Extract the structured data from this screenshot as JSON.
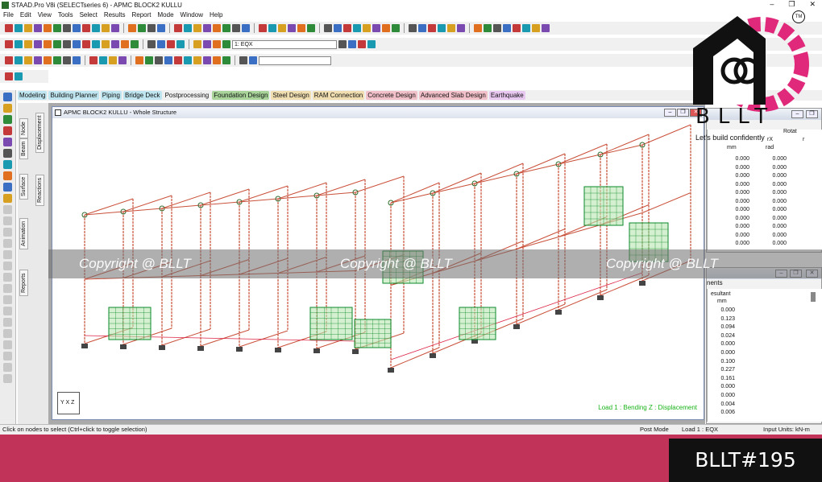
{
  "window": {
    "title": "STAAD.Pro V8i (SELECTseries 6) - APMC BLOCK2 KULLU",
    "minimize": "–",
    "restore": "❐",
    "close": "✕"
  },
  "menu": [
    "File",
    "Edit",
    "View",
    "Tools",
    "Select",
    "Results",
    "Report",
    "Mode",
    "Window",
    "Help"
  ],
  "toolbar": {
    "load_case": "1: EQX"
  },
  "tabs": [
    {
      "label": "Modeling",
      "color": "#bfe6f0"
    },
    {
      "label": "Building Planner",
      "color": "#bfe6f0"
    },
    {
      "label": "Piping",
      "color": "#bfe6f0"
    },
    {
      "label": "Bridge Deck",
      "color": "#bfe6f0"
    },
    {
      "label": "Postprocessing",
      "color": "#f0f0f0"
    },
    {
      "label": "Foundation Design",
      "color": "#a8d49a"
    },
    {
      "label": "Steel Design",
      "color": "#f0ddb0"
    },
    {
      "label": "RAM Connection",
      "color": "#f0ddb0"
    },
    {
      "label": "Concrete Design",
      "color": "#f2c0c8"
    },
    {
      "label": "Advanced Slab Design",
      "color": "#f2c0c8"
    },
    {
      "label": "Earthquake",
      "color": "#e8c8f0"
    }
  ],
  "side_tabs": [
    "Node",
    "Beam",
    "Surface",
    "Animation",
    "Reports",
    "Displacement",
    "Reactions"
  ],
  "viewport": {
    "title": "APMC BLOCK2 KULLU - Whole Structure",
    "load_label": "Load 1 : Bending Z : Displacement",
    "axis_label": "Y X Z"
  },
  "panel_top": {
    "headers": [
      "rX",
      "Rotat",
      "mm",
      "rad",
      "r"
    ],
    "rows": [
      [
        "0.000",
        "0.000"
      ],
      [
        "0.000",
        "0.000"
      ],
      [
        "0.000",
        "0.000"
      ],
      [
        "0.000",
        "0.000"
      ],
      [
        "0.000",
        "0.000"
      ],
      [
        "0.000",
        "0.000"
      ],
      [
        "0.000",
        "0.000"
      ],
      [
        "0.000",
        "0.000"
      ],
      [
        "0.000",
        "0.000"
      ],
      [
        "0.000",
        "0.000"
      ],
      [
        "0.000",
        "0.000"
      ]
    ]
  },
  "panel_bottom": {
    "tab": "nents",
    "headers": [
      "esultant",
      "mm"
    ],
    "rows": [
      "0.000",
      "0.123",
      "0.094",
      "0.024",
      "0.000",
      "0.000",
      "0.100",
      "0.227",
      "0.161",
      "0.000",
      "0.000",
      "0.004",
      "0.006"
    ]
  },
  "status": {
    "left": "Click on nodes to select (Ctrl+click to toggle selection)",
    "mode": "Post Mode",
    "load": "Load 1 : EQX",
    "units": "Input Units:  kN-m"
  },
  "watermark": "Copyright @ BLLT",
  "brand": {
    "logo_text": "BLLT",
    "tagline": "Let's build confidently",
    "tm": "TM",
    "hashtag": "BLLT#195"
  },
  "colors": {
    "footer": "#c2335a",
    "gear": "#e0297a",
    "load_label": "#19b319"
  }
}
